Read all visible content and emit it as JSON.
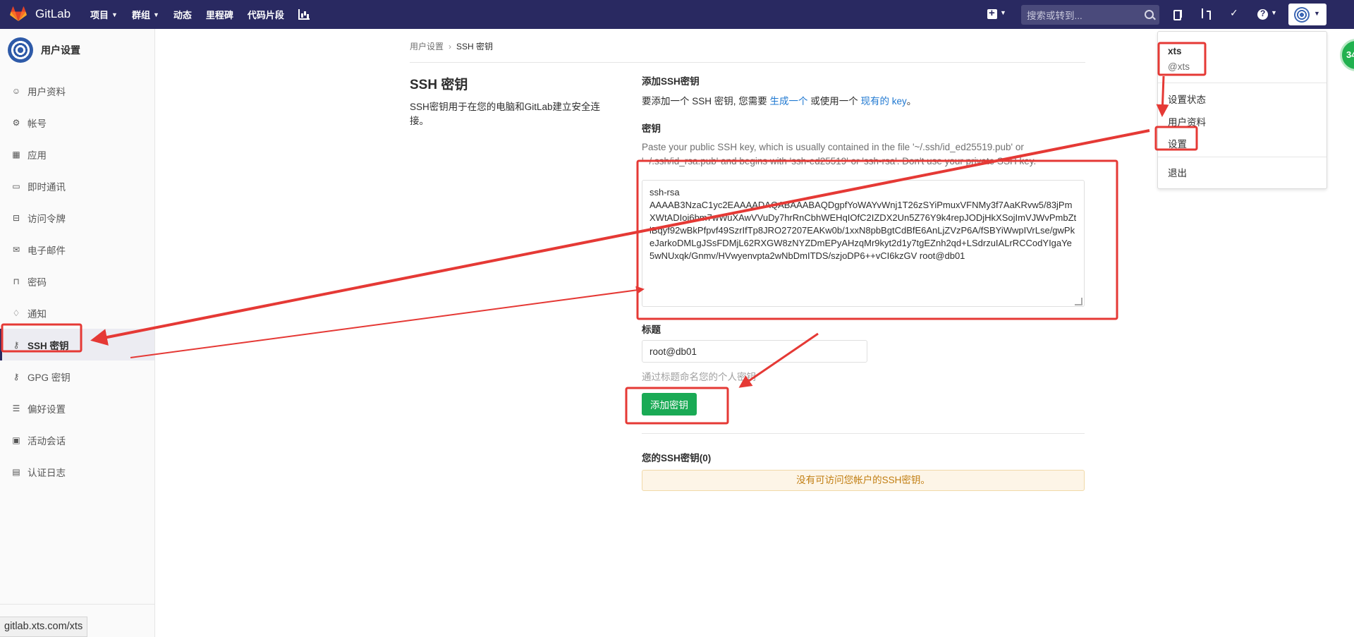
{
  "nav": {
    "brand": "GitLab",
    "menu": [
      {
        "label": "项目",
        "caret": true
      },
      {
        "label": "群组",
        "caret": true
      },
      {
        "label": "动态",
        "caret": false
      },
      {
        "label": "里程碑",
        "caret": false
      },
      {
        "label": "代码片段",
        "caret": false
      }
    ],
    "search_placeholder": "搜索或转到..."
  },
  "sidebar": {
    "title": "用户设置",
    "items": [
      {
        "label": "用户资料",
        "icon": "user-circle-icon"
      },
      {
        "label": "帐号",
        "icon": "account-gear-icon"
      },
      {
        "label": "应用",
        "icon": "grid-icon"
      },
      {
        "label": "即时通讯",
        "icon": "chat-icon"
      },
      {
        "label": "访问令牌",
        "icon": "token-icon"
      },
      {
        "label": "电子邮件",
        "icon": "envelope-icon"
      },
      {
        "label": "密码",
        "icon": "lock-icon"
      },
      {
        "label": "通知",
        "icon": "bell-icon"
      },
      {
        "label": "SSH 密钥",
        "icon": "key-icon",
        "active": true
      },
      {
        "label": "GPG 密钥",
        "icon": "key-icon"
      },
      {
        "label": "偏好设置",
        "icon": "sliders-icon"
      },
      {
        "label": "活动会话",
        "icon": "monitor-icon"
      },
      {
        "label": "认证日志",
        "icon": "log-icon"
      }
    ]
  },
  "status_url": "gitlab.xts.com/xts",
  "breadcrumb": {
    "parent": "用户设置",
    "current": "SSH 密钥"
  },
  "page": {
    "title": "SSH 密钥",
    "description": "SSH密钥用于在您的电脑和GitLab建立安全连接。"
  },
  "form": {
    "add_heading": "添加SSH密钥",
    "add_text_before": "要添加一个 SSH 密钥, 您需要 ",
    "generate_link": "生成一个",
    "add_text_mid": " 或使用一个 ",
    "existing_link": "现有的 key",
    "add_text_after": "。",
    "key_label": "密钥",
    "key_hint": "Paste your public SSH key, which is usually contained in the file '~/.ssh/id_ed25519.pub' or '~/.ssh/id_rsa.pub' and begins with 'ssh-ed25519' or 'ssh-rsa'. Don't use your private SSH key.",
    "key_value": "ssh-rsa\nAAAAB3NzaC1yc2EAAAADAQABAAABAQDgpfYoWAYvWnj1T26zSYiPmuxVFNMy3f7AaKRvw5/83jPmXWtADIoi6bm7wWuXAwVVuDy7hrRnCbhWEHqIOfC2IZDX2Un5Z76Y9k4repJODjHkXSojImVJWvPmbZtlBqyf92wBkPfpvf49SzrIfTp8JRO27207EAKw0b/1xxN8pbBgtCdBfE6AnLjZVzP6A/fSBYiWwpIVrLse/gwPkeJarkoDMLgJSsFDMjL62RXGW8zNYZDmEPyAHzqMr9kyt2d1y7tgEZnh2qd+LSdrzuIALrRCCodYIgaYe5wNUxqk/Gnmv/HVwyenvpta2wNbDmITDS/szjoDP6++vCI6kzGV root@db01",
    "title_label": "标题",
    "title_value": "root@db01",
    "title_hint": "通过标题命名您的个人密钥",
    "submit_label": "添加密钥",
    "your_keys": "您的SSH密钥(0)",
    "empty_message": "没有可访问您帐户的SSH密钥。"
  },
  "user_dropdown": {
    "name": "xts",
    "handle": "@xts",
    "items": [
      "设置状态",
      "用户资料",
      "设置"
    ],
    "signout": "退出"
  },
  "badge_text": "34",
  "colors": {
    "navbar": "#292961",
    "link": "#1f78d1",
    "success_button": "#1aaa55",
    "warning_bg": "#fdf5e7",
    "annotation_red": "#e53935"
  }
}
